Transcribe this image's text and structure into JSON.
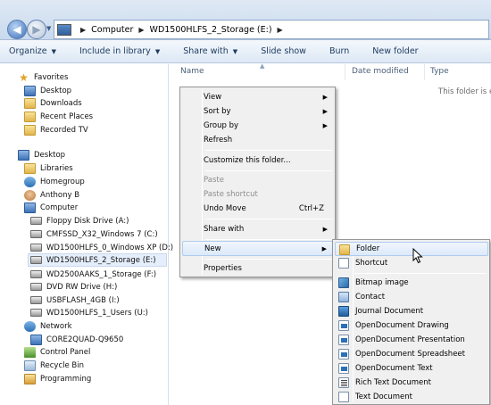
{
  "address": {
    "crumbs": [
      "Computer",
      "WD1500HLFS_2_Storage (E:)"
    ]
  },
  "toolbar": {
    "items": [
      "Organize",
      "Include in library",
      "Share with",
      "Slide show",
      "Burn",
      "New folder"
    ]
  },
  "columns": {
    "name": "Name",
    "date_modified": "Date modified",
    "type": "Type"
  },
  "empty_message": "This folder is em",
  "nav": {
    "favorites": "Favorites",
    "desktop": "Desktop",
    "downloads": "Downloads",
    "recent_places": "Recent Places",
    "recorded_tv": "Recorded TV",
    "desktop_root": "Desktop",
    "libraries": "Libraries",
    "homegroup": "Homegroup",
    "user": "Anthony B",
    "computer": "Computer",
    "drives": [
      "Floppy Disk Drive (A:)",
      "CMFSSD_X32_Windows 7 (C:)",
      "WD1500HLFS_0_Windows XP (D:)",
      "WD1500HLFS_2_Storage (E:)",
      "WD2500AAKS_1_Storage (F:)",
      "DVD RW Drive (H:)",
      "USBFLASH_4GB (I:)",
      "WD1500HLFS_1_Users (U:)"
    ],
    "network": "Network",
    "network_pc": "CORE2QUAD-Q9650",
    "control_panel": "Control Panel",
    "recycle_bin": "Recycle Bin",
    "programming": "Programming"
  },
  "context_menu": {
    "view": "View",
    "sort_by": "Sort by",
    "group_by": "Group by",
    "refresh": "Refresh",
    "customize": "Customize this folder...",
    "paste": "Paste",
    "paste_shortcut": "Paste shortcut",
    "undo_move": "Undo Move",
    "undo_shortcut": "Ctrl+Z",
    "share_with": "Share with",
    "new": "New",
    "properties": "Properties"
  },
  "new_submenu": {
    "folder": "Folder",
    "shortcut": "Shortcut",
    "items": [
      "Bitmap image",
      "Contact",
      "Journal Document",
      "OpenDocument Drawing",
      "OpenDocument Presentation",
      "OpenDocument Spreadsheet",
      "OpenDocument Text",
      "Rich Text Document",
      "Text Document"
    ]
  }
}
